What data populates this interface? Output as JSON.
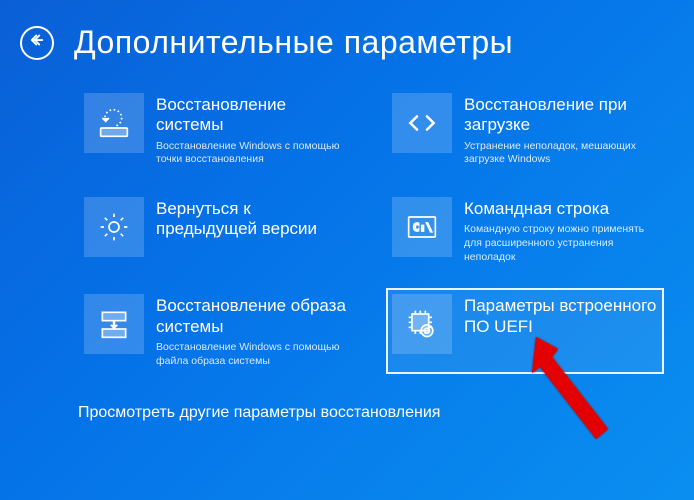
{
  "header": {
    "title": "Дополнительные параметры"
  },
  "tiles": [
    {
      "title": "Восстановление системы",
      "desc": "Восстановление Windows с помощью точки восстановления"
    },
    {
      "title": "Восстановление при загрузке",
      "desc": "Устранение неполадок, мешающих загрузке Windows"
    },
    {
      "title": "Вернуться к предыдущей версии",
      "desc": ""
    },
    {
      "title": "Командная строка",
      "desc": "Командную строку можно применять для расширенного устранения неполадок"
    },
    {
      "title": "Восстановление образа системы",
      "desc": "Восстановление Windows с помощью файла образа системы"
    },
    {
      "title": "Параметры встроенного ПО UEFI",
      "desc": ""
    }
  ],
  "footer": {
    "more": "Просмотреть другие параметры восстановления"
  }
}
